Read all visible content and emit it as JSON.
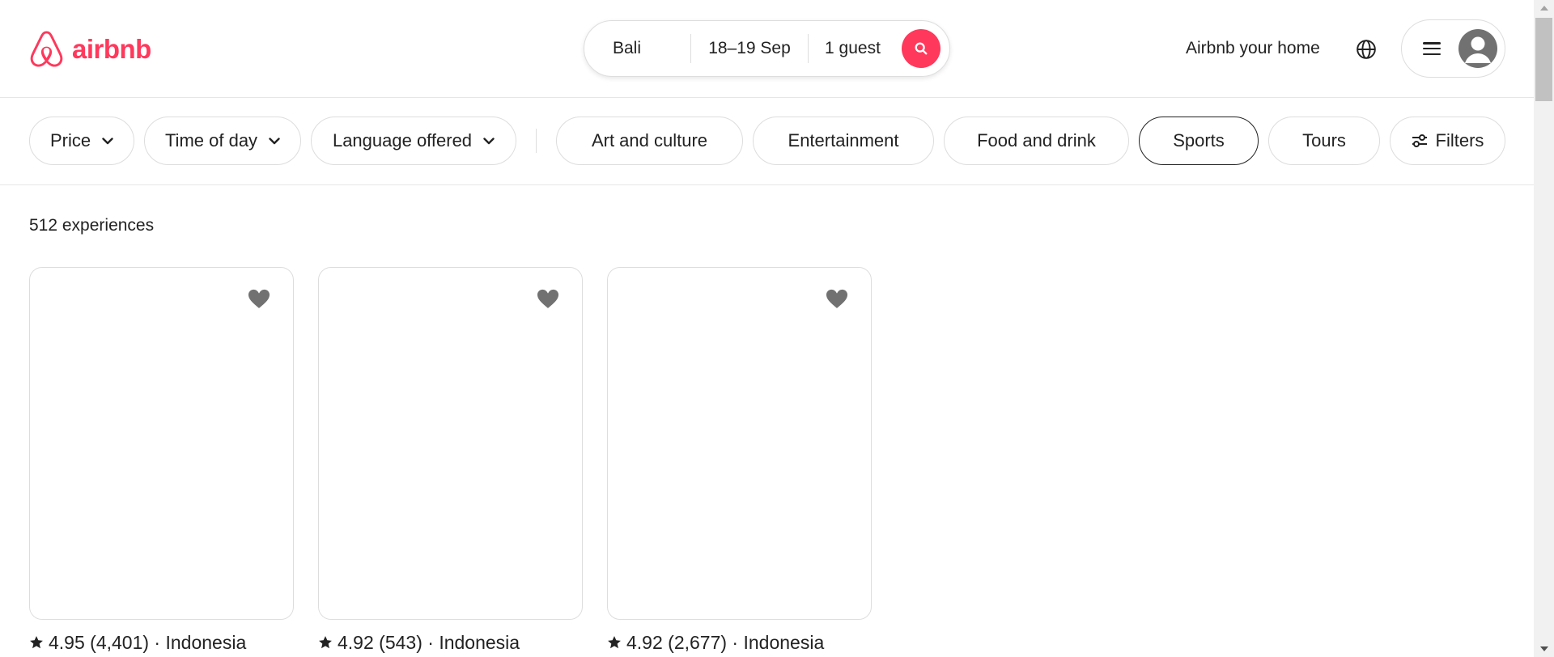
{
  "brand": {
    "name": "airbnb",
    "color": "#FF385C"
  },
  "search": {
    "location": "Bali",
    "dates": "18–19 Sep",
    "guests": "1 guest",
    "button_icon": "search-icon"
  },
  "header": {
    "host_link": "Airbnb your home",
    "globe_icon": "globe-icon",
    "menu_icon": "hamburger-menu-icon",
    "avatar_icon": "user-avatar-icon"
  },
  "filters": {
    "dropdowns": [
      "Price",
      "Time of day",
      "Language offered"
    ],
    "categories": [
      "Art and culture",
      "Entertainment",
      "Food and drink",
      "Sports",
      "Tours"
    ],
    "selected_category": "Sports",
    "filters_label": "Filters"
  },
  "results": {
    "count_label": "512 experiences"
  },
  "cards": [
    {
      "rating": "4.95",
      "reviews": "(4,401)",
      "separator": "·",
      "location": "Indonesia"
    },
    {
      "rating": "4.92",
      "reviews": "(543)",
      "separator": "·",
      "location": "Indonesia"
    },
    {
      "rating": "4.92",
      "reviews": "(2,677)",
      "separator": "·",
      "location": "Indonesia"
    }
  ]
}
